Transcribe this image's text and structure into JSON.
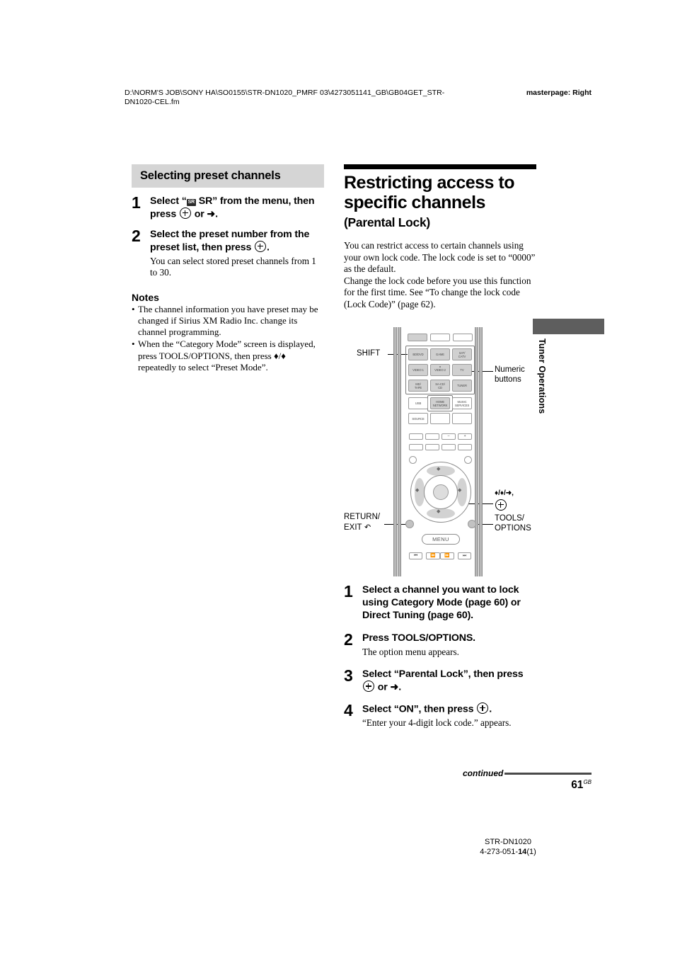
{
  "header": {
    "path": "D:\\NORM'S JOB\\SONY HA\\SO0155\\STR-DN1020_PMRF 03\\4273051141_GB\\GB04GET_STR-DN1020-CEL.fm",
    "masterpage": "masterpage: Right"
  },
  "side_tab": {
    "label": "Tuner Operations"
  },
  "left_column": {
    "heading": "Selecting preset channels",
    "steps": [
      {
        "num": "1",
        "title_prefix": "Select “",
        "badge": "SR",
        "title_mid": " SR” from the menu, then press ",
        "title_suffix": " or ➜.",
        "desc": ""
      },
      {
        "num": "2",
        "title_prefix": "Select the preset number from the preset list, then press ",
        "title_suffix": ".",
        "desc": "You can select stored preset channels from 1 to 30."
      }
    ],
    "notes_title": "Notes",
    "notes": [
      "The channel information you have preset may be changed if Sirius XM Radio Inc. change its channel programming.",
      "When the “Category Mode” screen is displayed, press TOOLS/OPTIONS, then press ♦/♦ repeatedly to select “Preset Mode”."
    ]
  },
  "right_column": {
    "title_line1": "Restricting access to",
    "title_line2": "specific channels",
    "subtitle": "(Parental Lock)",
    "intro": "You can restrict access to certain channels using your own lock code. The lock code is set to “0000” as the default.",
    "intro2": "Change the lock code before you use this function for the first time. See “To change the lock code (Lock Code)” (page 62).",
    "steps": [
      {
        "num": "1",
        "title": "Select a channel you want to lock using Category Mode (page 60) or Direct Tuning (page 60).",
        "desc": ""
      },
      {
        "num": "2",
        "title": "Press TOOLS/OPTIONS.",
        "desc": "The option menu appears."
      },
      {
        "num": "3",
        "title_prefix": "Select “Parental Lock”, then press ",
        "title_suffix": " or ➜.",
        "desc": ""
      },
      {
        "num": "4",
        "title_prefix": "Select “ON”, then press ",
        "title_suffix": ".",
        "desc": "“Enter your 4-digit lock code.” appears."
      }
    ]
  },
  "remote": {
    "callouts": {
      "shift": "SHIFT",
      "numeric": "Numeric\nbuttons",
      "numeric_line1": "Numeric",
      "numeric_line2": "buttons",
      "return_line1": "RETURN/",
      "return_line2": "EXIT",
      "arrows": "♦/♦/➜,",
      "tools_line1": "TOOLS/",
      "tools_line2": "OPTIONS"
    },
    "buttons": {
      "top_row": [
        "",
        "",
        ""
      ],
      "input_grid": [
        "BD/DVD",
        "GAME",
        "SAT/\nCATV",
        "VIDEO 1",
        "VIDEO 2",
        "TV",
        "MD/\nTAPE",
        "SA-CD/\nCD",
        "TUNER"
      ],
      "row4": [
        "USB",
        "HOME\nNETWORK",
        "MUSIC\nSERVICES"
      ],
      "row5": [
        "SOURCE",
        "",
        ""
      ],
      "vol_row": [
        "",
        "",
        "–",
        "+"
      ],
      "menu": "MENU"
    }
  },
  "footer": {
    "continued": "continued",
    "page": "61",
    "page_sup": "GB",
    "model": "STR-DN1020",
    "part_prefix": "4-273-051-",
    "part_bold": "14",
    "part_suffix": "(1)"
  }
}
